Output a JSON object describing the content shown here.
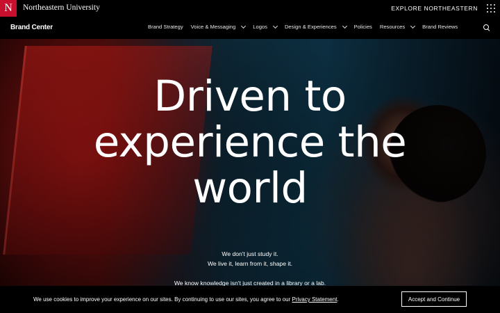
{
  "topbar": {
    "logo_letter": "N",
    "university_name": "Northeastern University",
    "explore_label": "EXPLORE NORTHEASTERN"
  },
  "navbar": {
    "brand": "Brand Center",
    "items": [
      {
        "label": "Brand Strategy",
        "has_dropdown": false
      },
      {
        "label": "Voice & Messaging",
        "has_dropdown": true
      },
      {
        "label": "Logos",
        "has_dropdown": true
      },
      {
        "label": "Design & Experiences",
        "has_dropdown": true
      },
      {
        "label": "Policies",
        "has_dropdown": false
      },
      {
        "label": "Resources",
        "has_dropdown": true
      },
      {
        "label": "Brand Reviews",
        "has_dropdown": false
      }
    ]
  },
  "hero": {
    "headline_lines": [
      "Driven to",
      "experience the",
      "world"
    ],
    "sub_lines": [
      "We don't just study it.",
      "We live it, learn from it, shape it."
    ],
    "sub_line_2": "We know knowledge isn't just created in a library or a lab."
  },
  "cookie": {
    "text": "We use cookies to improve your experience on our sites. By continuing to use our sites, you agree to our ",
    "link": "Privacy Statement",
    "text_end": ".",
    "button": "Accept and Continue"
  },
  "colors": {
    "brand_red": "#c8102e",
    "bar_background": "#000000",
    "text": "#ffffff"
  }
}
